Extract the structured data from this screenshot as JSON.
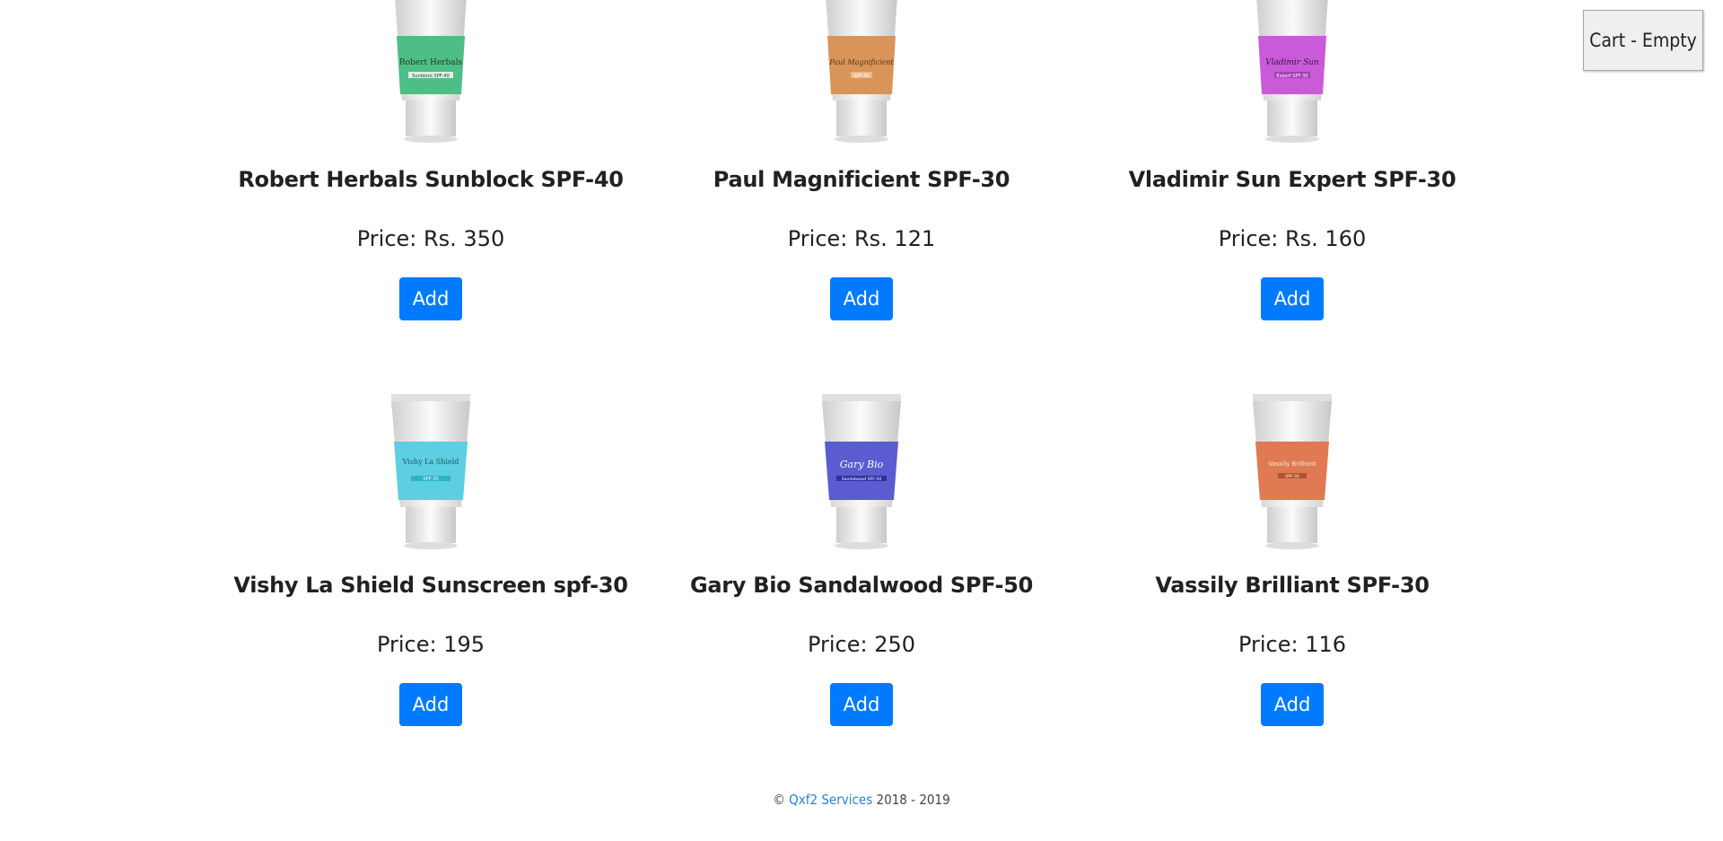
{
  "header": {
    "cart_label": "Cart - Empty"
  },
  "products": [
    {
      "name": "Robert Herbals Sunblock SPF-40",
      "price": "Price: Rs. 350",
      "add_label": "Add",
      "label_color": "#4fbe86",
      "tube_text": "Robert Herbals",
      "tube_sub": "Sunblock SPF-40"
    },
    {
      "name": "Paul Magnificient SPF-30",
      "price": "Price: Rs. 121",
      "add_label": "Add",
      "label_color": "#d9945a",
      "tube_text": "Paul Magnificient",
      "tube_sub": "SPF-30"
    },
    {
      "name": "Vladimir Sun Expert SPF-30",
      "price": "Price: Rs. 160",
      "add_label": "Add",
      "label_color": "#c95bd8",
      "tube_text": "Vladimir Sun",
      "tube_sub": "Expert SPF-30"
    },
    {
      "name": "Vishy La Shield Sunscreen spf-30",
      "price": "Price: 195",
      "add_label": "Add",
      "label_color": "#5ccfe2",
      "tube_text": "Vishy La Shield",
      "tube_sub": "SPF-30"
    },
    {
      "name": "Gary Bio Sandalwood SPF-50",
      "price": "Price: 250",
      "add_label": "Add",
      "label_color": "#5b5ccf",
      "tube_text": "Gary Bio",
      "tube_sub": "Sandalwood SPF-50"
    },
    {
      "name": "Vassily Brilliant SPF-30",
      "price": "Price: 116",
      "add_label": "Add",
      "label_color": "#df7a52",
      "tube_text": "Vassily Brilliant",
      "tube_sub": "SPF-30"
    }
  ],
  "footer": {
    "copyright_symbol": "©",
    "company": "Qxf2 Services",
    "years": "2018 - 2019"
  }
}
